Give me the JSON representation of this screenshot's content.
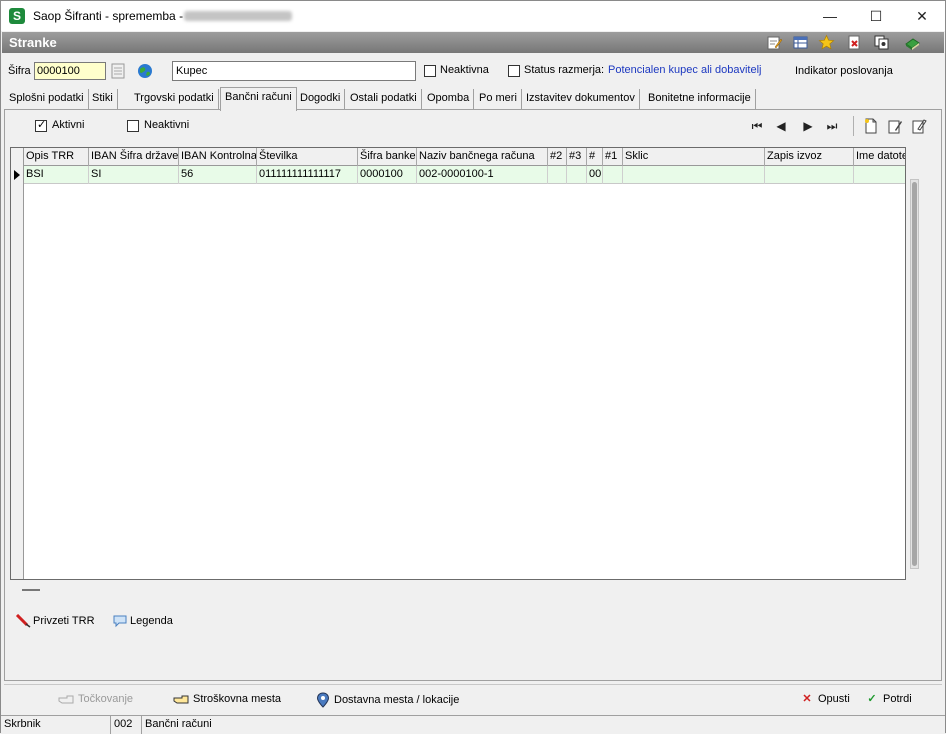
{
  "window": {
    "title": "Saop Šifranti - sprememba - "
  },
  "header": {
    "title": "Stranke",
    "icons": [
      "edit-notes-icon",
      "table-list-icon",
      "star-icon",
      "delete-red-icon",
      "copy-settings-icon",
      "book-green-icon"
    ]
  },
  "form": {
    "sifra_label": "Šifra",
    "sifra_value": "0000100",
    "name_value": "Kupec",
    "neaktivna_label": "Neaktivna",
    "neaktivna_checked": false,
    "status_label": "Status razmerja:",
    "status_checked": false,
    "status_value": "Potencialen kupec ali dobavitelj",
    "indikator_label": "Indikator poslovanja"
  },
  "tabs": [
    {
      "label": "Splošni podatki"
    },
    {
      "label": "Stiki"
    },
    {
      "label": "Trgovski podatki"
    },
    {
      "label": "Bančni računi"
    },
    {
      "label": "Dogodki"
    },
    {
      "label": "Ostali podatki"
    },
    {
      "label": "Opomba"
    },
    {
      "label": "Po meri"
    },
    {
      "label": "Izstavitev dokumentov"
    },
    {
      "label": "Bonitetne informacije"
    }
  ],
  "active_tab": "Bančni računi",
  "filters": {
    "aktivni_label": "Aktivni",
    "aktivni_checked": true,
    "neaktivni_label": "Neaktivni",
    "neaktivni_checked": false
  },
  "grid": {
    "columns": [
      "Opis TRR",
      "IBAN Šifra države",
      "IBAN Kontrolna",
      "Številka",
      "Šifra banke",
      "Naziv bančnega računa",
      "#2",
      "#3",
      "#",
      "#1",
      "Sklic",
      "Zapis izvoz",
      "Ime datote"
    ],
    "rows": [
      [
        "BSI",
        "SI",
        "56",
        "011111111111117",
        "0000100",
        "002-0000100-1",
        "",
        "",
        "00",
        "",
        "",
        "",
        ""
      ]
    ]
  },
  "actions": {
    "privzeti_trr": "Privzeti TRR",
    "legenda": "Legenda"
  },
  "bottom": {
    "tockovanje": "Točkovanje",
    "stroskovna_mesta": "Stroškovna mesta",
    "dostavna_mesta": "Dostavna mesta / lokacije",
    "opusti": "Opusti",
    "potrdi": "Potrdi"
  },
  "status": {
    "user": "Skrbnik",
    "code": "002",
    "context": "Bančni računi"
  },
  "colors": {
    "header_gray": "#8a8a8a",
    "row_green": "#e8fbe8",
    "link_blue": "#1c38c0",
    "sifra_yellow": "#ffffcc"
  }
}
